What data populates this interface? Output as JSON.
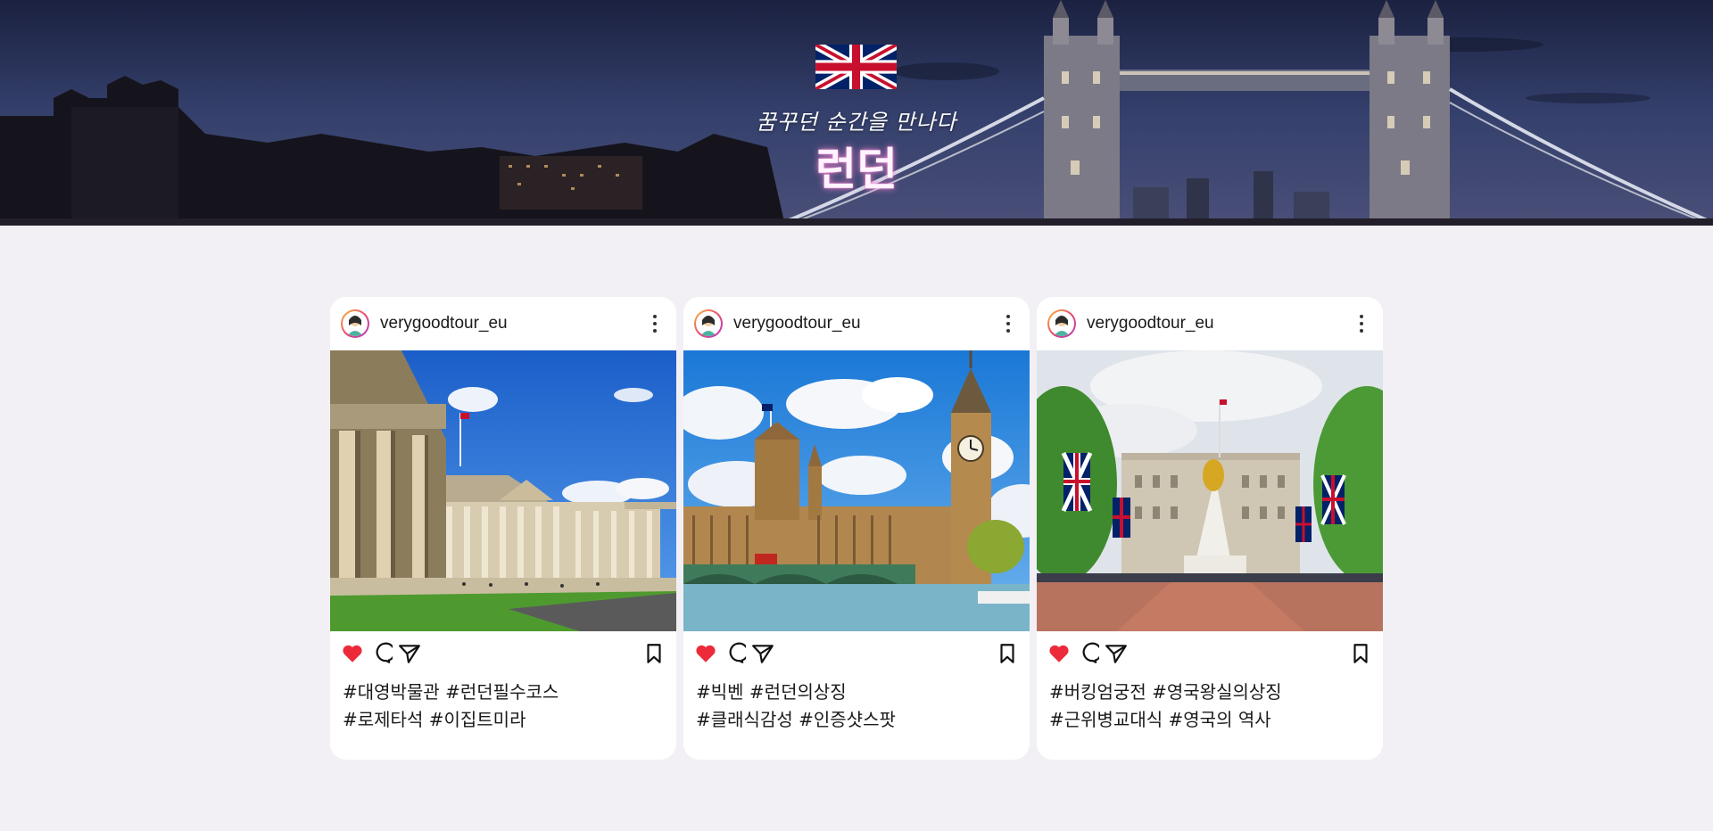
{
  "hero": {
    "subtitle": "꿈꾸던 순간을 만나다",
    "title": "런던",
    "flag_icon": "uk-flag-icon"
  },
  "colors": {
    "page_bg": "#f3f0f5",
    "like_red": "#ed2a3a",
    "title_glow": "#ff7ad0"
  },
  "posts": [
    {
      "username": "verygoodtour_eu",
      "photo": "British Museum",
      "caption_line1": "#대영박물관 #런던필수코스",
      "caption_line2": "#로제타석 #이집트미라"
    },
    {
      "username": "verygoodtour_eu",
      "photo": "Big Ben and Westminster",
      "caption_line1": "#빅벤 #런던의상징",
      "caption_line2": "#클래식감성 #인증샷스팟"
    },
    {
      "username": "verygoodtour_eu",
      "photo": "Buckingham Palace",
      "caption_line1": "#버킹엄궁전 #영국왕실의상징",
      "caption_line2": "#근위병교대식 #영국의 역사"
    }
  ]
}
